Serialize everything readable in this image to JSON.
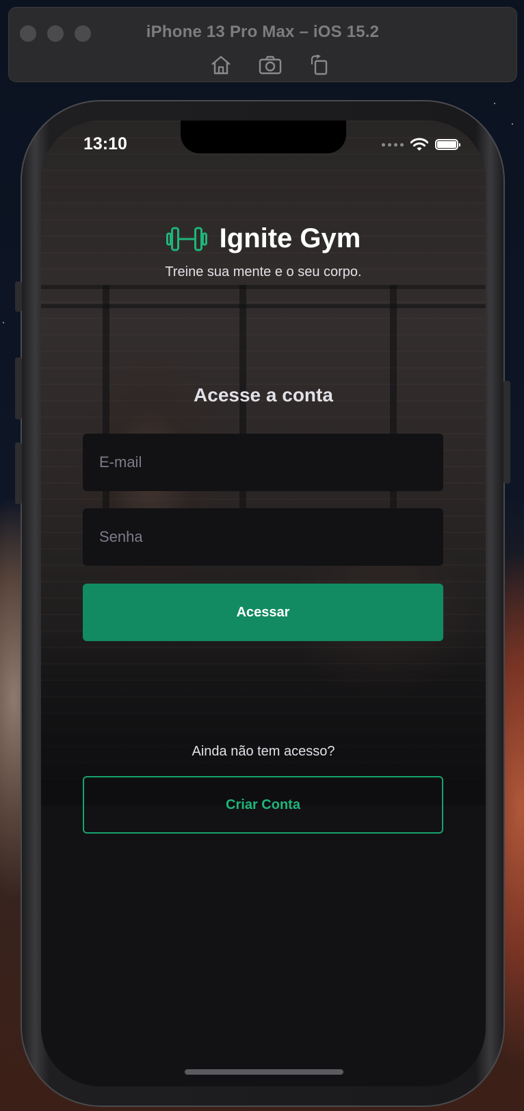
{
  "simulator": {
    "title": "iPhone 13 Pro Max – iOS 15.2",
    "tools": [
      "home-icon",
      "camera-icon",
      "rotate-icon"
    ]
  },
  "status_bar": {
    "time": "13:10"
  },
  "app": {
    "brand_title": "Ignite Gym",
    "tagline": "Treine sua mente e o seu corpo.",
    "form_title": "Acesse a conta",
    "email_placeholder": "E-mail",
    "password_placeholder": "Senha",
    "login_label": "Acessar",
    "no_access_text": "Ainda não tem acesso?",
    "create_account_label": "Criar Conta"
  },
  "colors": {
    "accent": "#128a62",
    "accent_text": "#1fb57a",
    "background": "#121214",
    "input_background": "#121214"
  }
}
